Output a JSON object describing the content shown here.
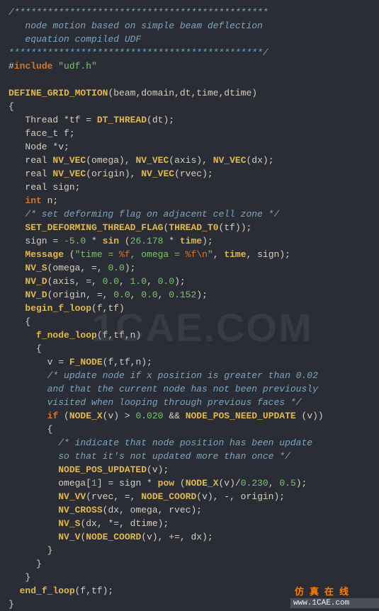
{
  "code": {
    "comment_top": "/**********************************************\n   node motion based on simple beam deflection\n   equation compiled UDF\n**********************************************/",
    "include_hash": "#",
    "include_kw": "include",
    "include_file": "\"udf.h\"",
    "define_grid_motion": "DEFINE_GRID_MOTION",
    "dgm_args": "(beam,domain,dt,time,dtime)",
    "lbrace": "{",
    "thread_decl_a": "   Thread *tf = ",
    "thread_decl_fn": "DT_THREAD",
    "thread_decl_b": "(dt);",
    "face_decl": "   face_t f;",
    "node_decl": "   Node *v;",
    "real1a": "   real ",
    "nvvec": "NV_VEC",
    "real1b": "(omega), ",
    "real1c": "(axis), ",
    "real1d": "(dx);",
    "real2a": "   real ",
    "real2b": "(origin), ",
    "real2c": "(rvec);",
    "real3": "   real sign;",
    "int_kw": "int",
    "int_rest": " n;",
    "comment_flag": "/* set deforming flag on adjacent cell zone */",
    "set_deform": "SET_DEFORMING_THREAD_FLAG",
    "thread_t0": "THREAD_T0",
    "set_deform_tail": "(tf));",
    "sign_a": "   sign = ",
    "neg5": "-5.0",
    "star": " * ",
    "sin": "sin",
    "sin_open": " (",
    "v26": "26.178",
    "star2": " * ",
    "time_var": "time",
    "sign_b": ");",
    "message": "Message",
    "msg_open": " (",
    "msg_str1": "\"time = ",
    "esc_f1": "%f",
    "msg_str2": ", omega = ",
    "esc_f2": "%f",
    "esc_n": "\\n",
    "msg_str3": "\"",
    "msg_args": ", ",
    "msg_time": "time",
    "msg_sign": ", sign);",
    "nvs": "NV_S",
    "nvs_args_a": "(omega, =, ",
    "zero": "0.0",
    "close_paren": ");",
    "nvd": "NV_D",
    "nvd_axis_a": "(axis, =, ",
    "one": "1.0",
    "comma_sp": ", ",
    "nvd_origin_a": "(origin, =, ",
    "v0152": "0.152",
    "begin_f_loop": "begin_f_loop",
    "bfl_args": "(f,tf)",
    "f_node_loop": "f_node_loop",
    "fnl_args": "(f,tf,n)",
    "v_eq": "       v = ",
    "f_node": "F_NODE",
    "f_node_args": "(f,tf,n);",
    "comment_update": "/* update node if x position is greater than 0.02\n       and that the current node has not been previously\n       visited when looping through previous faces */",
    "if_kw": "if",
    "node_x": "NODE_X",
    "if_a": " (",
    "if_b": "(v) > ",
    "v0020": "0.020",
    "and": " && ",
    "node_pos_need": "NODE_POS_NEED_UPDATE",
    "if_c": " (v))",
    "comment_indicate": "/* indicate that node position has been update\n         so that it's not updated more than once */",
    "node_pos_updated": "NODE_POS_UPDATED",
    "npu_args": "(v);",
    "omega_idx_a": "         omega[",
    "one_idx": "1",
    "omega_idx_b": "] = sign * ",
    "pow": "pow",
    "pow_a": " (",
    "pow_b": "(v)/",
    "v0230": "0.230",
    "v05": "0.5",
    "pow_c": ");",
    "nv_vv": "NV_VV",
    "nv_vv_args_a": "(rvec, =, ",
    "node_coord": "NODE_COORD",
    "nv_vv_args_b": "(v), -, origin);",
    "nv_cross": "NV_CROSS",
    "nv_cross_args": "(dx, omega, rvec);",
    "nvs2_args": "(dx, *=, dtime);",
    "nv_v": "NV_V",
    "nv_v_args_a": "(",
    "nv_v_args_b": "(v), +=, dx);",
    "rbrace": "}",
    "end_f_loop": "end_f_loop",
    "efl_args": "(f,tf);"
  },
  "watermark": "1CAE.COM",
  "footer": {
    "chars": "仿真在线",
    "url": "www.1CAE.com"
  }
}
